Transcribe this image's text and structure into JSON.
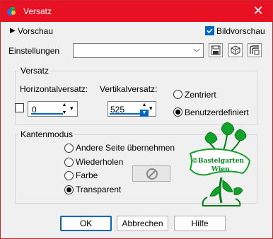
{
  "window": {
    "title": "Versatz",
    "close_symbol": "✕"
  },
  "toolbar": {
    "preview_toggle": "Vorschau",
    "bildvorschau_label": "Bildvorschau",
    "bildvorschau_checked": true
  },
  "settings": {
    "label": "Einstellungen",
    "value": ""
  },
  "versatz": {
    "legend": "Versatz",
    "horizontal_label": "Horizontalversatz:",
    "horizontal_value": "0",
    "vertical_label": "Vertikalversatz:",
    "vertical_value": "525",
    "link_checked": false,
    "zentriert_label": "Zentriert",
    "zentriert_checked": false,
    "benutzerdefiniert_label": "Benutzerdefiniert",
    "benutzerdefiniert_checked": true
  },
  "kantenmodus": {
    "legend": "Kantenmodus",
    "options": [
      {
        "label": "Andere Seite übernehmen",
        "checked": false
      },
      {
        "label": "Wiederholen",
        "checked": false
      },
      {
        "label": "Farbe",
        "checked": false
      },
      {
        "label": "Transparent",
        "checked": true
      }
    ]
  },
  "watermark": {
    "line1": "©Bastelgarten",
    "line2": "Wien"
  },
  "buttons": {
    "ok": "OK",
    "cancel": "Abbrechen",
    "help": "Hilfe"
  },
  "colors": {
    "titlebar": "#e81123",
    "accent": "#0067c0",
    "watermark": "#12a12a"
  }
}
